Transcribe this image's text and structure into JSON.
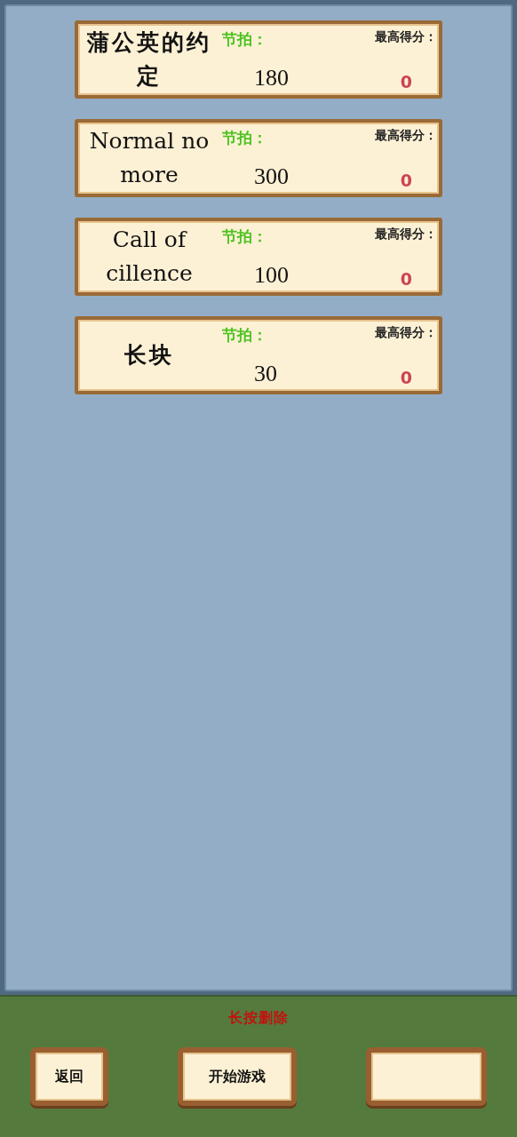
{
  "songs": [
    {
      "title": "蒲公英的约定",
      "beat_label": "节拍：",
      "bpm": "180",
      "score_label": "最高得分：",
      "score": "0"
    },
    {
      "title": "Normal no more",
      "beat_label": "节拍：",
      "bpm": "300",
      "score_label": "最高得分：",
      "score": "0"
    },
    {
      "title": "Call of cillence",
      "beat_label": "节拍：",
      "bpm": "100",
      "score_label": "最高得分：",
      "score": "0"
    },
    {
      "title": "长块",
      "beat_label": "节拍：",
      "bpm": "30",
      "score_label": "最高得分：",
      "score": "0"
    }
  ],
  "hint": "长按删除",
  "buttons": [
    {
      "kind": "labeled",
      "label": "返回"
    },
    {
      "kind": "labeled",
      "label": "开始游戏"
    },
    {
      "kind": "blank"
    }
  ]
}
